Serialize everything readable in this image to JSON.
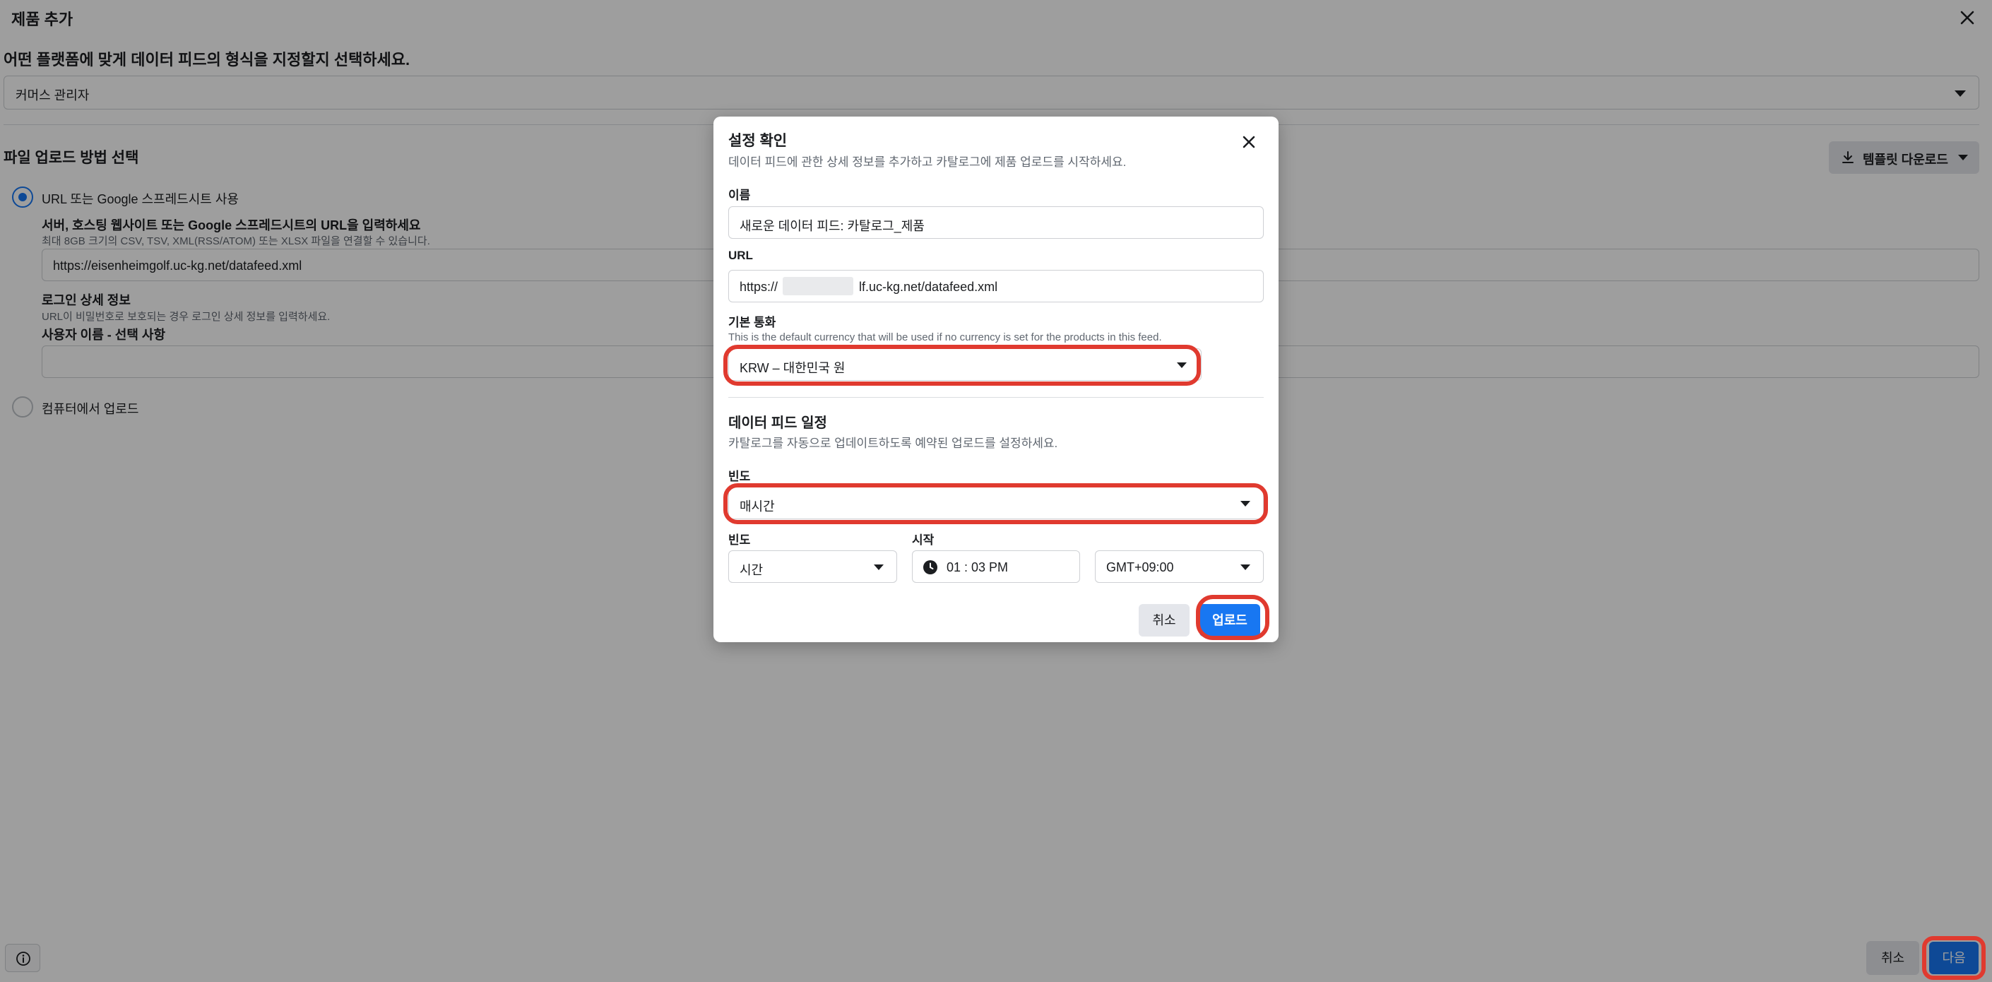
{
  "background": {
    "title": "제품 추가",
    "question": "어떤 플랫폼에 맞게 데이터 피드의 형식을 지정할지 선택하세요.",
    "platform_select": "커머스 관리자",
    "section_title": "파일 업로드 방법 선택",
    "template_button": "템플릿 다운로드",
    "option_url": "URL 또는 Google 스프레드시트 사용",
    "url_field_label": "서버, 호스팅 웹사이트 또는 Google 스프레드시트의 URL을 입력하세요",
    "url_field_help": "최대 8GB 크기의 CSV, TSV, XML(RSS/ATOM) 또는 XLSX 파일을 연결할 수 있습니다.",
    "url_value": "https://eisenheimgolf.uc-kg.net/datafeed.xml",
    "login_label": "로그인 상세 정보",
    "login_help": "URL이 비밀번호로 보호되는 경우 로그인 상세 정보를 입력하세요.",
    "username_label": "사용자 이름 - 선택 사항",
    "username_value": "",
    "option_computer": "컴퓨터에서 업로드",
    "cancel": "취소",
    "next": "다음"
  },
  "modal": {
    "title": "설정 확인",
    "subtitle": "데이터 피드에 관한 상세 정보를 추가하고 카탈로그에 제품 업로드를 시작하세요.",
    "name_label": "이름",
    "name_value": "새로운 데이터 피드: 카탈로그_제품",
    "url_label": "URL",
    "url_prefix": "https://",
    "url_suffix": "lf.uc-kg.net/datafeed.xml",
    "currency_label": "기본 통화",
    "currency_help": "This is the default currency that will be used if no currency is set for the products in this feed.",
    "currency_value": "KRW – 대한민국 원",
    "schedule_title": "데이터 피드 일정",
    "schedule_sub": "카탈로그를 자동으로 업데이트하도록 예약된 업로드를 설정하세요.",
    "frequency_label": "빈도",
    "frequency_value": "매시간",
    "interval_label": "빈도",
    "interval_value": "시간",
    "start_label": "시작",
    "start_value": "01 : 03 PM",
    "timezone_value": "GMT+09:00",
    "cancel": "취소",
    "upload": "업로드"
  },
  "colors": {
    "primary": "#1877f2",
    "highlight": "#e03a2f",
    "overlay": "rgba(0,0,0,0.38)"
  }
}
